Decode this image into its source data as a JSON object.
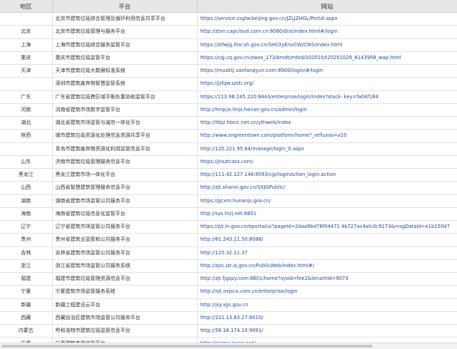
{
  "table": {
    "headers": {
      "region": "地区",
      "platform": "平台",
      "url": "网站"
    },
    "rows": [
      {
        "region": "",
        "platform": "北京市建筑垃圾综合管理及循环利用信息共享平台",
        "url": "https://service.csglw.beijing.gov.cn/JZLJZHGL/Portal.aspx"
      },
      {
        "region": "北京",
        "platform": "北京市建筑垃圾管理与服务平台",
        "url": "http://ztxn.capcloud.com.cn:8080/dist/index.html#/login"
      },
      {
        "region": "上海",
        "platform": "上海市建筑垃圾综合服务监管平台",
        "url": "https://ztfwjg.lhsr.sh.gov.cn/SHCityEnvCW/CWS/index.html"
      },
      {
        "region": "重庆",
        "platform": "重庆市建筑垃圾监管平台",
        "url": "https://cqj.cq.gov.cn/zwxx_173/bmdt/mtkd/202010/t20201029_8143958_wap.html"
      },
      {
        "region": "天津",
        "platform": "天津市建筑垃圾大数据标准系统",
        "url": "https://musktj.vanfanqyun.com:8900/login/#/login"
      },
      {
        "region": "",
        "platform": "深圳市建筑废弃物智慧监管系统",
        "url": "https://jzfqw.szsti.org/"
      },
      {
        "region": "广东",
        "platform": "广东省建筑垃圾跨区域平衡处置协助监管平台",
        "url": "https://113.98.245.220:8443/enterprise/login/index?stack- key=fa04f184"
      },
      {
        "region": "河南",
        "platform": "河南省建筑市场数字监管平台",
        "url": "http://hnqcjs.hnjs.henan.gov.cn/admin/login"
      },
      {
        "region": "湖北",
        "platform": "湖北省建筑市场监管与诚信一体化平台",
        "url": "http://hbjz.hbcic.net.cn/ythweb/index"
      },
      {
        "region": "陕西",
        "platform": "城市建筑垃圾资源化处理信息资源共享平台",
        "url": "http://www.sngreentown.com/platform/home?_refluxos=a10"
      },
      {
        "region": "",
        "platform": "青岛市建筑废弃物资源化利用监管信息平台",
        "url": "http://120.221.95.64/manage/login_0.aspx"
      },
      {
        "region": "山东",
        "platform": "济南市建筑垃圾管理服务信息平台",
        "url": "https://jnsztczzx.com/"
      },
      {
        "region": "黑龙江",
        "platform": "黑龙江建筑市场一体化平台",
        "url": "http://111.42.127.146:8093/cjp/loginAction_login.action"
      },
      {
        "region": "山西",
        "platform": "山西省智慧建筑管理服务信息平台",
        "url": "http://zjt.shanxi.gov.cn/SXJGPublic/"
      },
      {
        "region": "湖南",
        "platform": "湖南省建筑市场监管公共服务平台",
        "url": "https://gcxm.hunanjs.gov.cn/"
      },
      {
        "region": "海南",
        "platform": "海南省建筑垃圾信息化监管平台",
        "url": "http://sys.hizj.net:8801"
      },
      {
        "region": "辽宁",
        "platform": "辽宁省建筑市场监管公共服务平台",
        "url": "https://zjt.ln.gov.cn/eportal/ui?pageId=2daa9bd76f04471 4b727ac4afc0c9173&msgDataId=e1b150d7"
      },
      {
        "region": "贵州",
        "platform": "贵州省建筑业监管和公共服务平台",
        "url": "http://61.243.11.50:8088/"
      },
      {
        "region": "吉林",
        "platform": "吉林省建筑市场监管公共服务平台",
        "url": "http://125.32.11.37"
      },
      {
        "region": "浙江",
        "platform": "浙江省建筑市场监管公共服务系统",
        "url": "http://zjsc.jst.zj.gov.cn/PublicWeb/index.html#/"
      },
      {
        "region": "福建",
        "platform": "福建市建筑垃圾管理资源信息平台",
        "url": "http://zjt.fjgqzy.com:8801/home?sysId=fee2&tenantId=9073"
      },
      {
        "region": "宁夏",
        "platform": "宁夏建筑市场监管服务系统",
        "url": "http://njt.nxjscx.com.cn/enterprise/login"
      },
      {
        "region": "新疆",
        "platform": "新疆工程建设云平台",
        "url": "http://jsy.xjjs.gov.cn"
      },
      {
        "region": "西藏",
        "platform": "西藏自治区建筑市场监管公共服务平台",
        "url": "http://221.13.83.27:8010/"
      },
      {
        "region": "内蒙古",
        "platform": "呼和浩特市建筑垃圾监管信息平台",
        "url": "http://58.18.174.10:9091/"
      },
      {
        "region": "广西",
        "platform": "广西建筑市场监管平台",
        "url": "http://gxjzsc.gxcic.net/"
      }
    ]
  }
}
